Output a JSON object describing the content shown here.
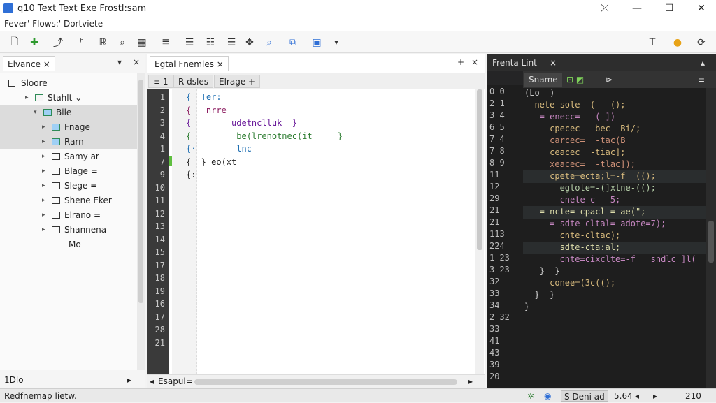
{
  "window": {
    "title": "q10 Text Text Exe Frostl:sam",
    "close_glyph": "✕",
    "maximize_glyph": "☐",
    "minimize_glyph": "—",
    "pin_glyph": "⤫"
  },
  "menu": {
    "text": "Fever' Flows:' Dortviete"
  },
  "toolbar": {
    "icons": [
      "new-file-icon",
      "add-icon",
      "open-icon",
      "text-icon",
      "bookmark-icon",
      "search-icon",
      "grid-icon",
      "list-icon",
      "numbered-list-icon",
      "bullet-list-icon",
      "indent-icon",
      "move-icon",
      "zoom-icon",
      "layers-icon",
      "image-icon",
      "dropdown-icon",
      "type-icon",
      "palette-icon",
      "refresh-icon"
    ],
    "glyphs": [
      "🗋",
      "✚",
      "⤴",
      "ʰ",
      "ℝ",
      "⌕",
      "▦",
      "≣",
      "☰",
      "☷",
      "☰",
      "✥",
      "⌕",
      "⧉",
      "▣",
      "▾",
      "T",
      "●",
      "⟳"
    ]
  },
  "left_panel": {
    "tab_label": "Elvance",
    "tab_close": "×",
    "menu_glyph": "▾",
    "close_glyph": "×",
    "rows": [
      {
        "label": "Sloore",
        "indent": 0,
        "arrow": "",
        "icon": "checkbox-icon",
        "selected": false
      },
      {
        "label": "Stahlt ⌄",
        "indent": 1,
        "arrow": "▸",
        "icon": "folder-icon",
        "selected": false
      },
      {
        "label": "Bile",
        "indent": 2,
        "arrow": "▾",
        "icon": "folder-icon",
        "selected": true
      },
      {
        "label": "Fnage",
        "indent": 3,
        "arrow": "▸",
        "icon": "folder-icon",
        "selected": true
      },
      {
        "label": "Rarn",
        "indent": 3,
        "arrow": "▸",
        "icon": "folder-icon",
        "selected": true
      },
      {
        "label": "Samy ar",
        "indent": 3,
        "arrow": "▸",
        "icon": "file-icon",
        "selected": false
      },
      {
        "label": "Blage =",
        "indent": 3,
        "arrow": "▸",
        "icon": "file-icon",
        "selected": false
      },
      {
        "label": "Slege =",
        "indent": 3,
        "arrow": "▸",
        "icon": "pencil-icon",
        "selected": false
      },
      {
        "label": "Shene Eker",
        "indent": 3,
        "arrow": "▸",
        "icon": "file-icon",
        "selected": false
      },
      {
        "label": "Elrano =",
        "indent": 3,
        "arrow": "▸",
        "icon": "file-icon",
        "selected": false
      },
      {
        "label": "Shannena",
        "indent": 3,
        "arrow": "▸",
        "icon": "file-icon",
        "selected": false
      },
      {
        "label": "Mo",
        "indent": 4,
        "arrow": "",
        "icon": "",
        "selected": false
      }
    ],
    "bottom_label": "1Dlo",
    "bottom_arrow": "▸"
  },
  "editor": {
    "tab_label": "Egtal Fnemles",
    "tab_close": "×",
    "add_glyph": "+",
    "close_glyph": "×",
    "subtabs": [
      "≡ 1",
      "R dsles",
      "Elrage +"
    ],
    "line_numbers": [
      "1",
      "2",
      "3",
      "4",
      "1",
      "7",
      "9",
      "10",
      "11",
      "12",
      "13",
      "14",
      "15",
      "17",
      "18",
      "19",
      "16",
      "17",
      "28",
      "21"
    ],
    "code_lines": [
      {
        "text": "{  Ter:",
        "color": "#1f6fb2"
      },
      {
        "text": "{   nrre",
        "color": "#8b1a5e"
      },
      {
        "text": "{        udetnclluk  }",
        "color": "#6a1b9a"
      },
      {
        "text": "{         be(lrenotnec(it     }",
        "color": "#2e7d32"
      },
      {
        "text": "{·        lnc",
        "color": "#1f6fb2"
      },
      {
        "text": "{  } eo(xt",
        "color": "#222222"
      },
      {
        "text": "{:",
        "color": "#222222"
      }
    ],
    "bottom_label": "Esapul=",
    "bottom_left_arrow": "◂",
    "bottom_right_arrow": "▸"
  },
  "right_panel": {
    "header_label": "Frenta Lint",
    "header_close": "×",
    "sub_items": [
      "Sname",
      "⊡ ◩",
      "⊳"
    ],
    "menu_glyph": "≡",
    "up_glyph": "▴",
    "line_numbers": [
      "0 0",
      "2 1",
      "3 4",
      "6 5",
      "7 4",
      "7 8",
      "8 9",
      "11",
      "12",
      "29",
      "21",
      "21",
      "113",
      "224",
      "1 23",
      "3 23",
      "32",
      "33",
      "34",
      "2 32",
      "33",
      "41",
      "43",
      "39",
      "20"
    ],
    "code_lines": [
      {
        "text": "(Lo  )",
        "color": "#c8c8c8"
      },
      {
        "text": "  nete-sole  (-  ();",
        "color": "#d7ba7d"
      },
      {
        "text": "   = enecc=-  ( ])",
        "color": "#c586c0"
      },
      {
        "text": "     cpecec  -bec  Bi/;",
        "color": "#d7ba7d"
      },
      {
        "text": "     carcec=  -tac(B",
        "color": "#ce9178"
      },
      {
        "text": "     ceacec  -tiac];",
        "color": "#d7ba7d"
      },
      {
        "text": "     xeacec=  -tlac]);",
        "color": "#ce9178"
      },
      {
        "text": "     cpete=ecta;l=-f  (();",
        "color": "#d7ba7d"
      },
      {
        "text": "       egtote=-(]xtne-(();",
        "color": "#b5cea8"
      },
      {
        "text": "       cnete-c  -5;",
        "color": "#c586c0"
      },
      {
        "text": "   = ncte=-cpacl-=-ae(\";",
        "color": "#dcdcaa"
      },
      {
        "text": "     = sdte-cltal=-adote=7);",
        "color": "#c586c0"
      },
      {
        "text": "       cnte-cltac);",
        "color": "#d7ba7d"
      },
      {
        "text": "       sdte-cta:al;",
        "color": "#dcdcaa"
      },
      {
        "text": "       cnte=cixclte=-f   sndlc ]l(",
        "color": "#c586c0"
      },
      {
        "text": "   }  }",
        "color": "#d4d4d4"
      },
      {
        "text": "     conee=(3c(();",
        "color": "#d7ba7d"
      },
      {
        "text": "  }  }",
        "color": "#d4d4d4"
      },
      {
        "text": "}",
        "color": "#d4d4d4"
      }
    ]
  },
  "statusbar": {
    "left_text": "Redfnemap lietw.",
    "gear_glyph": "✲",
    "circle_glyph": "◉",
    "mode_label": "S Deni ad",
    "position": "5.64",
    "prev_glyph": "◂",
    "next_glyph": "▸",
    "right_number": "210"
  }
}
